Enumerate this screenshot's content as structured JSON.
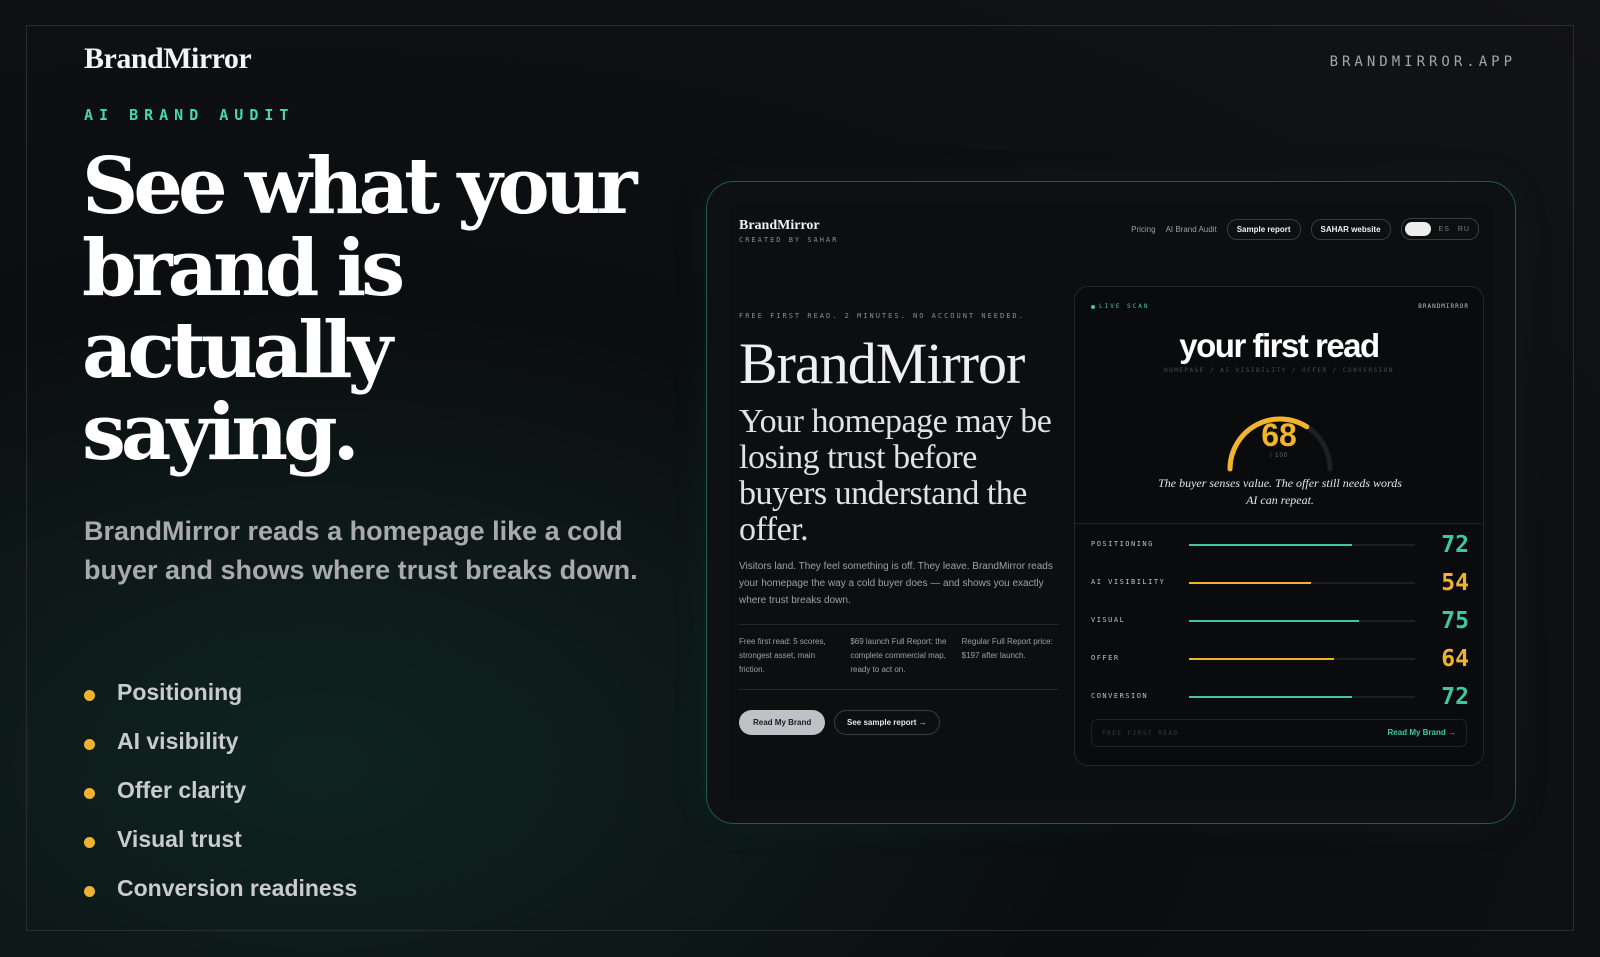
{
  "brand": {
    "logo": "BrandMirror",
    "domain": "BRANDMIRROR.APP"
  },
  "hero": {
    "eyebrow": "AI BRAND AUDIT",
    "headline": "See what your brand is actually saying.",
    "subhead": "BrandMirror reads a homepage like a cold buyer and shows where trust breaks down.",
    "bullets": [
      "Positioning",
      "AI visibility",
      "Offer clarity",
      "Visual trust",
      "Conversion readiness"
    ],
    "bullet_color": "#f0b232"
  },
  "mock": {
    "logo": "BrandMirror",
    "created_by": "CREATED BY SAHAR",
    "nav": {
      "pricing": "Pricing",
      "audit": "AI Brand Audit",
      "sample": "Sample report",
      "website": "SAHAR website",
      "lang1": "ES",
      "lang2": "RU"
    },
    "kicker": "FREE FIRST READ. 2 MINUTES. NO ACCOUNT NEEDED.",
    "title": "BrandMirror",
    "tagline": "Your homepage may be losing trust before buyers understand the offer.",
    "body": "Visitors land. They feel something is off. They leave. BrandMirror reads your homepage the way a cold buyer does — and shows you exactly where trust breaks down.",
    "columns": [
      "Free first read: 5 scores, strongest asset, main friction.",
      "$69 launch Full Report: the complete commercial map, ready to act on.",
      "Regular Full Report price: $197 after launch."
    ],
    "cta_primary": "Read My Brand",
    "cta_secondary": "See sample report →"
  },
  "card": {
    "live": "LIVE SCAN",
    "brand_tag": "BRANDMIRROR",
    "title": "your first read",
    "subtitle": "HOMEPAGE / AI VISIBILITY / OFFER / CONVERSION",
    "score": "68",
    "score_max": "/ 100",
    "score_value": 68,
    "quote": "The buyer senses value. The offer still needs words AI can repeat.",
    "rows": [
      {
        "label": "POSITIONING",
        "value": "72",
        "fraction": 0.72,
        "color": "#3fc89f"
      },
      {
        "label": "AI VISIBILITY",
        "value": "54",
        "fraction": 0.54,
        "color": "#f0b232"
      },
      {
        "label": "VISUAL",
        "value": "75",
        "fraction": 0.75,
        "color": "#3fc89f"
      },
      {
        "label": "OFFER",
        "value": "64",
        "fraction": 0.64,
        "color": "#f0b232"
      },
      {
        "label": "CONVERSION",
        "value": "72",
        "fraction": 0.72,
        "color": "#3fc89f"
      }
    ],
    "foot_left": "FREE FIRST READ",
    "foot_right": "Read My Brand →"
  },
  "colors": {
    "accent_green": "#49d6ae",
    "accent_amber": "#f2b430"
  }
}
